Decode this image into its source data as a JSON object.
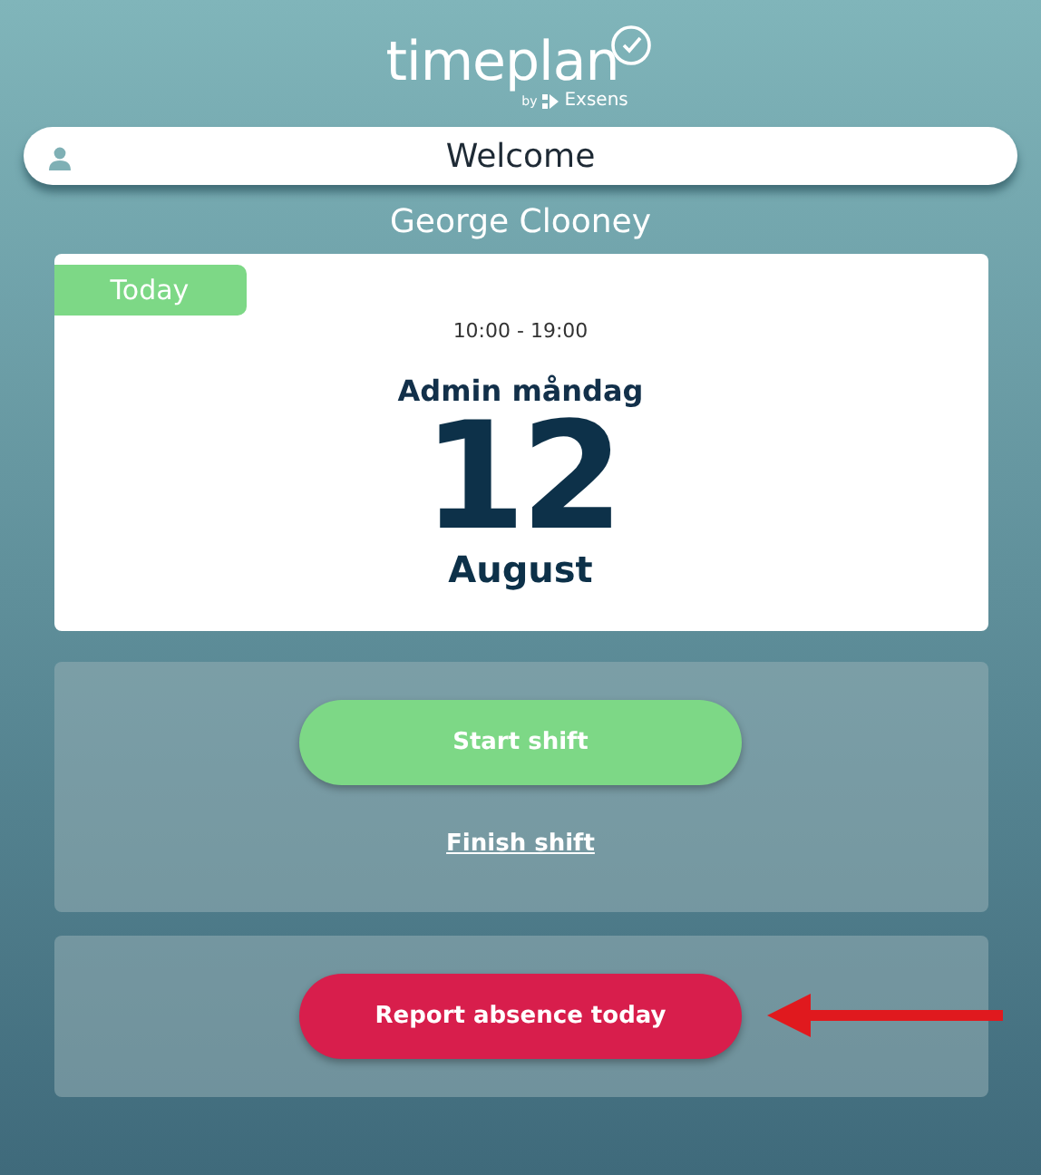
{
  "logo": {
    "name": "timeplan",
    "by": "by",
    "company": "Exsens"
  },
  "welcome": {
    "label": "Welcome"
  },
  "user_name": "George Clooney",
  "shift_card": {
    "badge": "Today",
    "time": "10:00 - 19:00",
    "title": "Admin måndag",
    "day": "12",
    "month": "August"
  },
  "shift_actions": {
    "start": "Start shift",
    "finish": "Finish shift"
  },
  "absence": {
    "button": "Report absence today",
    "annotation_arrow": true
  }
}
